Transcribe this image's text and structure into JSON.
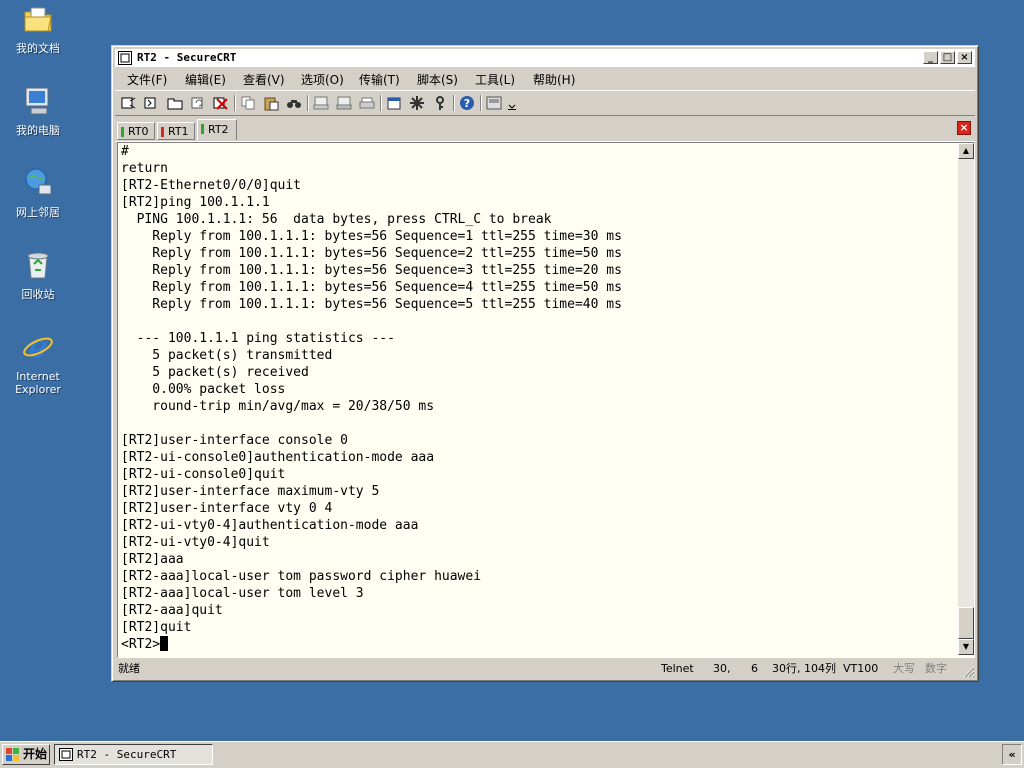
{
  "desktop": {
    "icons": [
      {
        "label": "我的文档",
        "icon": "my-documents-folder-icon"
      },
      {
        "label": "我的电脑",
        "icon": "my-computer-icon"
      },
      {
        "label": "网上邻居",
        "icon": "network-places-icon"
      },
      {
        "label": "回收站",
        "icon": "recycle-bin-icon"
      },
      {
        "label_line1": "Internet",
        "label_line2": "Explorer",
        "icon": "internet-explorer-icon"
      }
    ]
  },
  "window": {
    "title": "RT2 - SecureCRT",
    "controls": {
      "minimize": "_",
      "maximize": "□",
      "close": "×"
    },
    "menu": [
      "文件(F)",
      "编辑(E)",
      "查看(V)",
      "选项(O)",
      "传输(T)",
      "脚本(S)",
      "工具(L)",
      "帮助(H)"
    ],
    "tabs": [
      {
        "label": "RT0",
        "status_color": "#2da62d"
      },
      {
        "label": "RT1",
        "status_color": "#d9251b"
      },
      {
        "label": "RT2",
        "status_color": "#2da62d",
        "active": true
      }
    ],
    "terminal_lines": [
      "#",
      "return",
      "[RT2-Ethernet0/0/0]quit",
      "[RT2]ping 100.1.1.1",
      "  PING 100.1.1.1: 56  data bytes, press CTRL_C to break",
      "    Reply from 100.1.1.1: bytes=56 Sequence=1 ttl=255 time=30 ms",
      "    Reply from 100.1.1.1: bytes=56 Sequence=2 ttl=255 time=50 ms",
      "    Reply from 100.1.1.1: bytes=56 Sequence=3 ttl=255 time=20 ms",
      "    Reply from 100.1.1.1: bytes=56 Sequence=4 ttl=255 time=50 ms",
      "    Reply from 100.1.1.1: bytes=56 Sequence=5 ttl=255 time=40 ms",
      "",
      "  --- 100.1.1.1 ping statistics ---",
      "    5 packet(s) transmitted",
      "    5 packet(s) received",
      "    0.00% packet loss",
      "    round-trip min/avg/max = 20/38/50 ms",
      "",
      "[RT2]user-interface console 0",
      "[RT2-ui-console0]authentication-mode aaa",
      "[RT2-ui-console0]quit",
      "[RT2]user-interface maximum-vty 5",
      "[RT2]user-interface vty 0 4",
      "[RT2-ui-vty0-4]authentication-mode aaa",
      "[RT2-ui-vty0-4]quit",
      "[RT2]aaa",
      "[RT2-aaa]local-user tom password cipher huawei",
      "[RT2-aaa]local-user tom level 3",
      "[RT2-aaa]quit",
      "[RT2]quit"
    ],
    "prompt": "<RT2>",
    "status": {
      "ready": "就绪",
      "protocol": "Telnet",
      "row": "30,",
      "col": "6",
      "size": "30行, 104列",
      "emulation": "VT100",
      "caps": "大写",
      "num": "数字"
    },
    "scroll_position": 0.93
  },
  "taskbar": {
    "start_label": "开始",
    "task_label": "RT2 - SecureCRT",
    "tray_label": "«"
  },
  "colors": {
    "desktop": "#3a6ea5",
    "terminal_bg": "#fffef3",
    "chrome": "#d4d0c8"
  }
}
